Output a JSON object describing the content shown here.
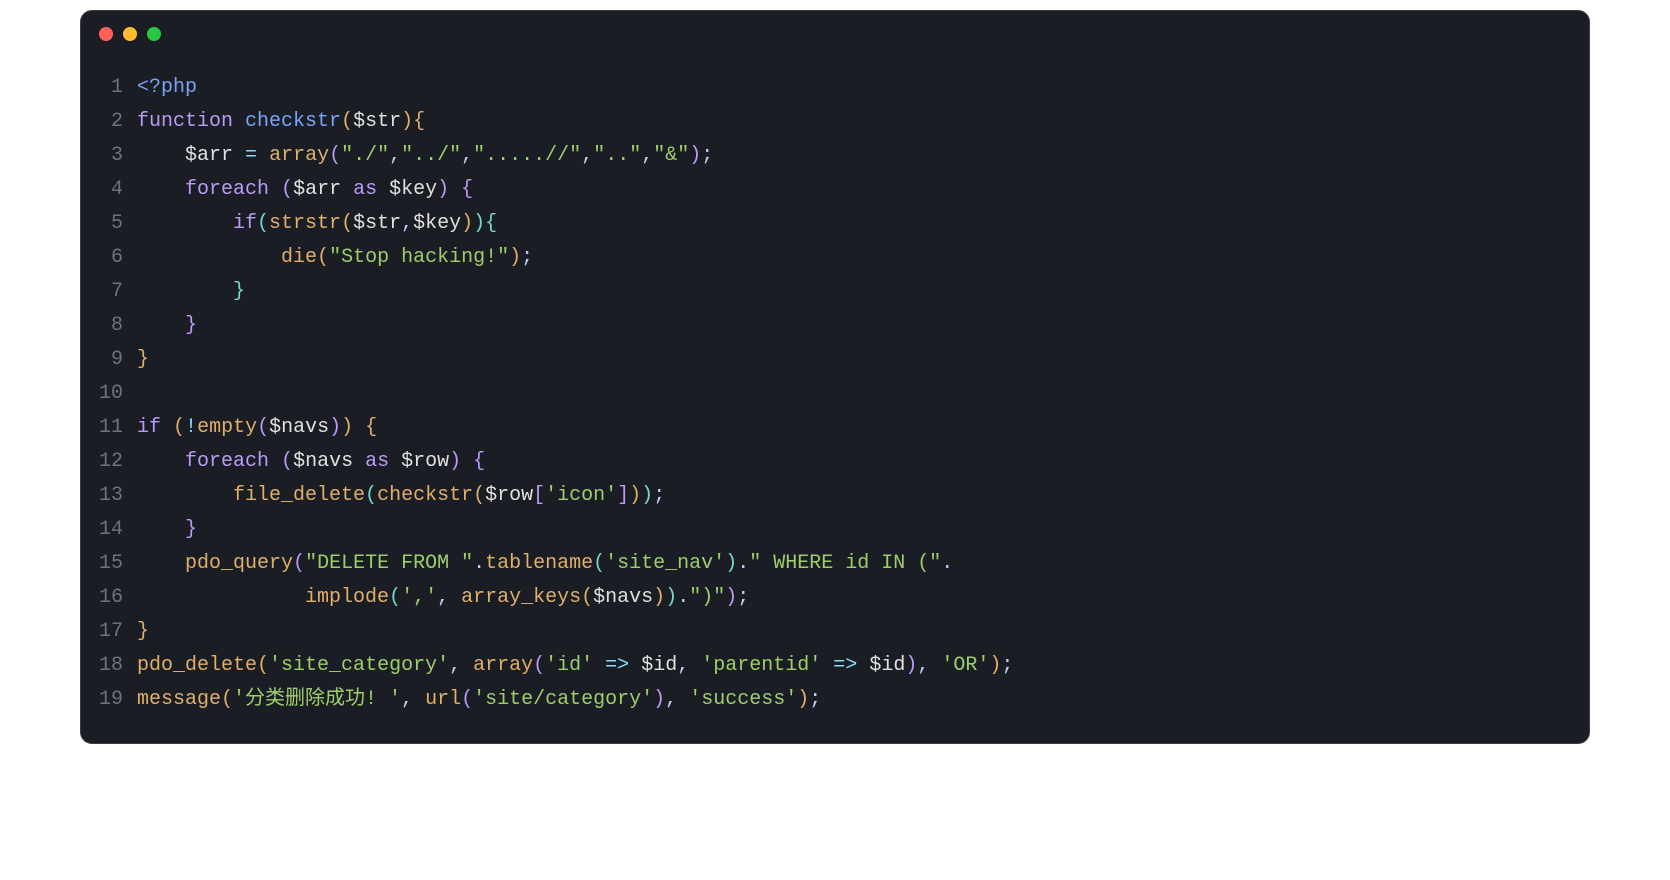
{
  "titlebar": {
    "buttons": [
      "close",
      "minimize",
      "maximize"
    ]
  },
  "code": {
    "lines": [
      {
        "n": "1",
        "tokens": [
          {
            "t": "<?php",
            "c": "tok-phptag"
          }
        ]
      },
      {
        "n": "2",
        "tokens": [
          {
            "t": "function",
            "c": "tok-keyword"
          },
          {
            "t": " ",
            "c": ""
          },
          {
            "t": "checkstr",
            "c": "tok-funcname"
          },
          {
            "t": "(",
            "c": "tok-paren-yellow"
          },
          {
            "t": "$str",
            "c": "tok-var"
          },
          {
            "t": ")",
            "c": "tok-paren-yellow"
          },
          {
            "t": "{",
            "c": "tok-paren-yellow"
          }
        ]
      },
      {
        "n": "3",
        "tokens": [
          {
            "t": "    ",
            "c": ""
          },
          {
            "t": "$arr",
            "c": "tok-var"
          },
          {
            "t": " ",
            "c": ""
          },
          {
            "t": "=",
            "c": "tok-op"
          },
          {
            "t": " ",
            "c": ""
          },
          {
            "t": "array",
            "c": "tok-funccall"
          },
          {
            "t": "(",
            "c": "tok-paren-purple"
          },
          {
            "t": "\"./\"",
            "c": "tok-string"
          },
          {
            "t": ",",
            "c": "tok-punct"
          },
          {
            "t": "\"../\"",
            "c": "tok-string"
          },
          {
            "t": ",",
            "c": "tok-punct"
          },
          {
            "t": "\".....//\"",
            "c": "tok-string"
          },
          {
            "t": ",",
            "c": "tok-punct"
          },
          {
            "t": "\"..\"",
            "c": "tok-string"
          },
          {
            "t": ",",
            "c": "tok-punct"
          },
          {
            "t": "\"&\"",
            "c": "tok-string"
          },
          {
            "t": ")",
            "c": "tok-paren-purple"
          },
          {
            "t": ";",
            "c": "tok-punct"
          }
        ]
      },
      {
        "n": "4",
        "tokens": [
          {
            "t": "    ",
            "c": ""
          },
          {
            "t": "foreach",
            "c": "tok-keyword"
          },
          {
            "t": " ",
            "c": ""
          },
          {
            "t": "(",
            "c": "tok-paren-purple"
          },
          {
            "t": "$arr",
            "c": "tok-var"
          },
          {
            "t": " ",
            "c": ""
          },
          {
            "t": "as",
            "c": "tok-keyword"
          },
          {
            "t": " ",
            "c": ""
          },
          {
            "t": "$key",
            "c": "tok-var"
          },
          {
            "t": ")",
            "c": "tok-paren-purple"
          },
          {
            "t": " ",
            "c": ""
          },
          {
            "t": "{",
            "c": "tok-paren-purple"
          }
        ]
      },
      {
        "n": "5",
        "tokens": [
          {
            "t": "        ",
            "c": ""
          },
          {
            "t": "if",
            "c": "tok-keyword"
          },
          {
            "t": "(",
            "c": "tok-paren-blue"
          },
          {
            "t": "strstr",
            "c": "tok-funccall"
          },
          {
            "t": "(",
            "c": "tok-paren-yellow"
          },
          {
            "t": "$str",
            "c": "tok-var"
          },
          {
            "t": ",",
            "c": "tok-punct"
          },
          {
            "t": "$key",
            "c": "tok-var"
          },
          {
            "t": ")",
            "c": "tok-paren-yellow"
          },
          {
            "t": ")",
            "c": "tok-paren-blue"
          },
          {
            "t": "{",
            "c": "tok-paren-blue"
          }
        ]
      },
      {
        "n": "6",
        "tokens": [
          {
            "t": "            ",
            "c": ""
          },
          {
            "t": "die",
            "c": "tok-funccall"
          },
          {
            "t": "(",
            "c": "tok-paren-yellow"
          },
          {
            "t": "\"Stop hacking!\"",
            "c": "tok-string"
          },
          {
            "t": ")",
            "c": "tok-paren-yellow"
          },
          {
            "t": ";",
            "c": "tok-punct"
          }
        ]
      },
      {
        "n": "7",
        "tokens": [
          {
            "t": "        ",
            "c": ""
          },
          {
            "t": "}",
            "c": "tok-paren-blue"
          }
        ]
      },
      {
        "n": "8",
        "tokens": [
          {
            "t": "    ",
            "c": ""
          },
          {
            "t": "}",
            "c": "tok-paren-purple"
          }
        ]
      },
      {
        "n": "9",
        "tokens": [
          {
            "t": "}",
            "c": "tok-paren-yellow"
          }
        ]
      },
      {
        "n": "10",
        "tokens": [
          {
            "t": "",
            "c": ""
          }
        ]
      },
      {
        "n": "11",
        "tokens": [
          {
            "t": "if",
            "c": "tok-keyword"
          },
          {
            "t": " ",
            "c": ""
          },
          {
            "t": "(",
            "c": "tok-paren-yellow"
          },
          {
            "t": "!",
            "c": "tok-op"
          },
          {
            "t": "empty",
            "c": "tok-funccall"
          },
          {
            "t": "(",
            "c": "tok-paren-purple"
          },
          {
            "t": "$navs",
            "c": "tok-var"
          },
          {
            "t": ")",
            "c": "tok-paren-purple"
          },
          {
            "t": ")",
            "c": "tok-paren-yellow"
          },
          {
            "t": " ",
            "c": ""
          },
          {
            "t": "{",
            "c": "tok-paren-yellow"
          }
        ]
      },
      {
        "n": "12",
        "tokens": [
          {
            "t": "    ",
            "c": ""
          },
          {
            "t": "foreach",
            "c": "tok-keyword"
          },
          {
            "t": " ",
            "c": ""
          },
          {
            "t": "(",
            "c": "tok-paren-purple"
          },
          {
            "t": "$navs",
            "c": "tok-var"
          },
          {
            "t": " ",
            "c": ""
          },
          {
            "t": "as",
            "c": "tok-keyword"
          },
          {
            "t": " ",
            "c": ""
          },
          {
            "t": "$row",
            "c": "tok-var"
          },
          {
            "t": ")",
            "c": "tok-paren-purple"
          },
          {
            "t": " ",
            "c": ""
          },
          {
            "t": "{",
            "c": "tok-paren-purple"
          }
        ]
      },
      {
        "n": "13",
        "tokens": [
          {
            "t": "        ",
            "c": ""
          },
          {
            "t": "file_delete",
            "c": "tok-funccall"
          },
          {
            "t": "(",
            "c": "tok-paren-blue"
          },
          {
            "t": "checkstr",
            "c": "tok-funccall"
          },
          {
            "t": "(",
            "c": "tok-paren-yellow"
          },
          {
            "t": "$row",
            "c": "tok-var"
          },
          {
            "t": "[",
            "c": "tok-paren-purple"
          },
          {
            "t": "'icon'",
            "c": "tok-string"
          },
          {
            "t": "]",
            "c": "tok-paren-purple"
          },
          {
            "t": ")",
            "c": "tok-paren-yellow"
          },
          {
            "t": ")",
            "c": "tok-paren-blue"
          },
          {
            "t": ";",
            "c": "tok-punct"
          }
        ]
      },
      {
        "n": "14",
        "tokens": [
          {
            "t": "    ",
            "c": ""
          },
          {
            "t": "}",
            "c": "tok-paren-purple"
          }
        ]
      },
      {
        "n": "15",
        "tokens": [
          {
            "t": "    ",
            "c": ""
          },
          {
            "t": "pdo_query",
            "c": "tok-funccall"
          },
          {
            "t": "(",
            "c": "tok-paren-purple"
          },
          {
            "t": "\"DELETE FROM \"",
            "c": "tok-string"
          },
          {
            "t": ".",
            "c": "tok-punct"
          },
          {
            "t": "tablename",
            "c": "tok-funccall"
          },
          {
            "t": "(",
            "c": "tok-paren-blue"
          },
          {
            "t": "'site_nav'",
            "c": "tok-string"
          },
          {
            "t": ")",
            "c": "tok-paren-blue"
          },
          {
            "t": ".",
            "c": "tok-punct"
          },
          {
            "t": "\" WHERE id IN (\"",
            "c": "tok-string"
          },
          {
            "t": ".",
            "c": "tok-punct"
          }
        ]
      },
      {
        "n": "16",
        "tokens": [
          {
            "t": "              ",
            "c": ""
          },
          {
            "t": "implode",
            "c": "tok-funccall"
          },
          {
            "t": "(",
            "c": "tok-paren-blue"
          },
          {
            "t": "','",
            "c": "tok-string"
          },
          {
            "t": ",",
            "c": "tok-punct"
          },
          {
            "t": " ",
            "c": ""
          },
          {
            "t": "array_keys",
            "c": "tok-funccall"
          },
          {
            "t": "(",
            "c": "tok-paren-yellow"
          },
          {
            "t": "$navs",
            "c": "tok-var"
          },
          {
            "t": ")",
            "c": "tok-paren-yellow"
          },
          {
            "t": ")",
            "c": "tok-paren-blue"
          },
          {
            "t": ".",
            "c": "tok-punct"
          },
          {
            "t": "\")\"",
            "c": "tok-string"
          },
          {
            "t": ")",
            "c": "tok-paren-purple"
          },
          {
            "t": ";",
            "c": "tok-punct"
          }
        ]
      },
      {
        "n": "17",
        "tokens": [
          {
            "t": "}",
            "c": "tok-paren-yellow"
          }
        ]
      },
      {
        "n": "18",
        "tokens": [
          {
            "t": "pdo_delete",
            "c": "tok-funccall"
          },
          {
            "t": "(",
            "c": "tok-paren-yellow"
          },
          {
            "t": "'site_category'",
            "c": "tok-string"
          },
          {
            "t": ",",
            "c": "tok-punct"
          },
          {
            "t": " ",
            "c": ""
          },
          {
            "t": "array",
            "c": "tok-funccall"
          },
          {
            "t": "(",
            "c": "tok-paren-purple"
          },
          {
            "t": "'id'",
            "c": "tok-string"
          },
          {
            "t": " ",
            "c": ""
          },
          {
            "t": "=>",
            "c": "tok-op"
          },
          {
            "t": " ",
            "c": ""
          },
          {
            "t": "$id",
            "c": "tok-var"
          },
          {
            "t": ",",
            "c": "tok-punct"
          },
          {
            "t": " ",
            "c": ""
          },
          {
            "t": "'parentid'",
            "c": "tok-string"
          },
          {
            "t": " ",
            "c": ""
          },
          {
            "t": "=>",
            "c": "tok-op"
          },
          {
            "t": " ",
            "c": ""
          },
          {
            "t": "$id",
            "c": "tok-var"
          },
          {
            "t": ")",
            "c": "tok-paren-purple"
          },
          {
            "t": ",",
            "c": "tok-punct"
          },
          {
            "t": " ",
            "c": ""
          },
          {
            "t": "'OR'",
            "c": "tok-string"
          },
          {
            "t": ")",
            "c": "tok-paren-yellow"
          },
          {
            "t": ";",
            "c": "tok-punct"
          }
        ]
      },
      {
        "n": "19",
        "tokens": [
          {
            "t": "message",
            "c": "tok-funccall"
          },
          {
            "t": "(",
            "c": "tok-paren-yellow"
          },
          {
            "t": "'分类删除成功! '",
            "c": "tok-string"
          },
          {
            "t": ",",
            "c": "tok-punct"
          },
          {
            "t": " ",
            "c": ""
          },
          {
            "t": "url",
            "c": "tok-funccall"
          },
          {
            "t": "(",
            "c": "tok-paren-purple"
          },
          {
            "t": "'site/category'",
            "c": "tok-string"
          },
          {
            "t": ")",
            "c": "tok-paren-purple"
          },
          {
            "t": ",",
            "c": "tok-punct"
          },
          {
            "t": " ",
            "c": ""
          },
          {
            "t": "'success'",
            "c": "tok-string"
          },
          {
            "t": ")",
            "c": "tok-paren-yellow"
          },
          {
            "t": ";",
            "c": "tok-punct"
          }
        ]
      }
    ]
  }
}
